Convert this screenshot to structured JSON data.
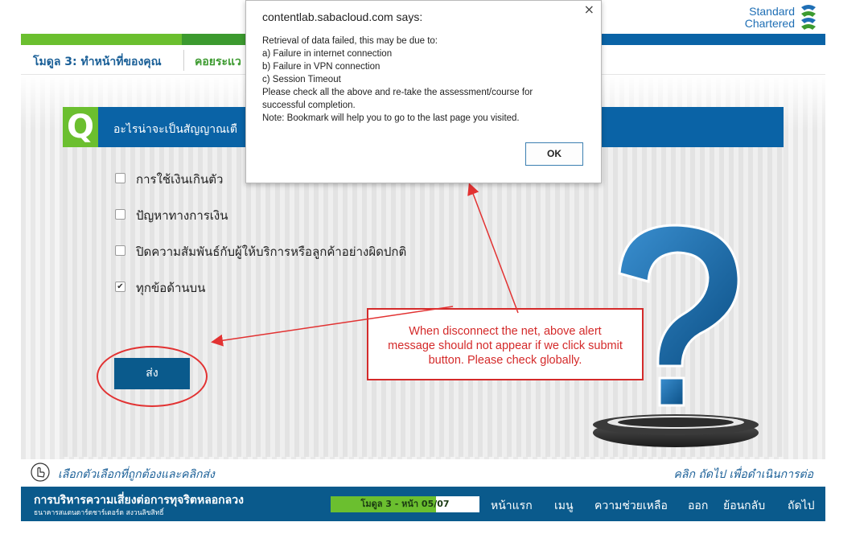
{
  "logo": {
    "line1": "Standard",
    "line2": "Chartered"
  },
  "breadcrumb": {
    "module": "โมดูล 3: ทำหน้าที่ของคุณ",
    "section": "คอยระแว"
  },
  "question": {
    "letter": "Q",
    "text": "อะไรน่าจะเป็นสัญญาณเตื",
    "options": [
      {
        "label": "การใช้เงินเกินตัว",
        "checked": false
      },
      {
        "label": "ปัญหาทางการเงิน",
        "checked": false
      },
      {
        "label": "ปิดความสัมพันธ์กับผู้ให้บริการหรือลูกค้าอย่างผิดปกติ",
        "checked": false
      },
      {
        "label": "ทุกข้อด้านบน",
        "checked": true
      }
    ],
    "submit_label": "ส่ง"
  },
  "alert": {
    "title": "contentlab.sabacloud.com says:",
    "close": "×",
    "lines": [
      "Retrieval of data failed, this may be due to:",
      "a) Failure in internet connection",
      "b) Failure in VPN connection",
      "c) Session Timeout",
      "Please check all the above and re-take the assessment/course for",
      "successful completion.",
      "Note: Bookmark will help you to go to the last page you visited."
    ],
    "ok_label": "OK"
  },
  "annotation": {
    "lines": [
      "When disconnect the net, above alert",
      "message should not appear if we click submit",
      "button. Please check globally."
    ]
  },
  "instructions": {
    "left": "เลือกตัวเลือกที่ถูกต้องและคลิกส่ง",
    "right": "คลิก ถัดไป เพื่อดำเนินการต่อ"
  },
  "footer": {
    "title": "การบริหารความเสี่ยงต่อการทุจริตหลอกลวง",
    "subtitle": "ธนาคารสแตนดาร์ดชาร์เตอร์ด สงวนลิขสิทธิ์",
    "progress_text": "โมดูล 3 - หน้า 05/07",
    "progress_fraction": 0.71,
    "nav": [
      "หน้าแรก",
      "เมนู",
      "ความช่วยเหลือ",
      "ออก",
      "ย้อนกลับ",
      "ถัดไป"
    ]
  },
  "colors": {
    "brand_blue": "#0a63a6",
    "brand_green": "#6bbf2f",
    "annotation_red": "#d42a2a"
  }
}
